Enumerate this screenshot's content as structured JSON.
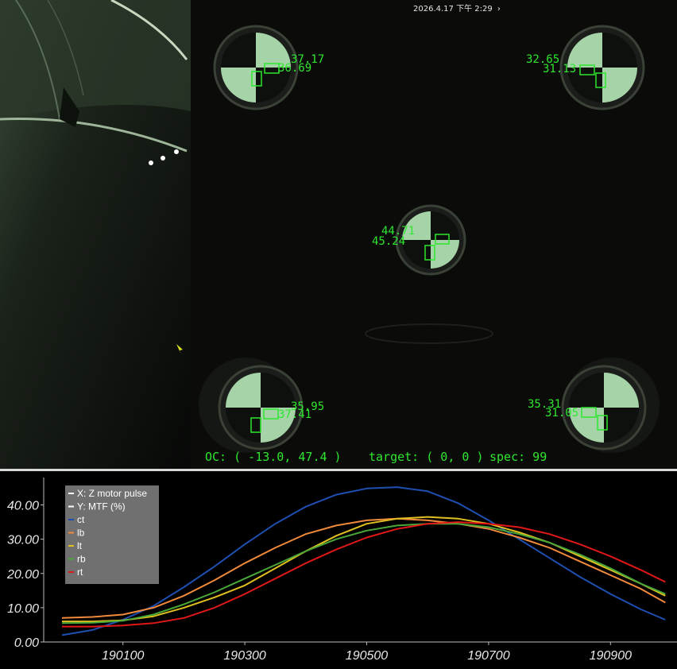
{
  "status_bar": {
    "timestamp": "2026.4.17 下午 2:29",
    "arrow_glyph": "›"
  },
  "camera": {
    "targets": [
      {
        "name": "lt",
        "value_a": "37.17",
        "value_b": "36.69"
      },
      {
        "name": "rt",
        "value_a": "32.65",
        "value_b": "31.13"
      },
      {
        "name": "ct",
        "value_a": "44.71",
        "value_b": "45.24"
      },
      {
        "name": "lb",
        "value_a": "35.95",
        "value_b": "37.41"
      },
      {
        "name": "rb",
        "value_a": "35.31",
        "value_b": "31.05"
      }
    ],
    "overlay": {
      "oc": "OC: ( -13.0, 47.4 )",
      "target": "target: ( 0, 0 )",
      "spec": "spec: 99"
    },
    "overlay_color": "#2fe62f"
  },
  "chart_data": {
    "type": "line",
    "x": [
      190000,
      190050,
      190100,
      190150,
      190200,
      190250,
      190300,
      190350,
      190400,
      190450,
      190500,
      190550,
      190600,
      190650,
      190700,
      190750,
      190800,
      190850,
      190900,
      190950,
      190990
    ],
    "series": [
      {
        "name": "ct",
        "color": "#1f4fb0",
        "values": [
          2.0,
          3.5,
          6.5,
          10.5,
          16.0,
          22.0,
          28.5,
          34.5,
          39.5,
          43.0,
          44.8,
          45.2,
          44.0,
          40.5,
          35.5,
          30.0,
          24.5,
          19.0,
          14.0,
          9.5,
          6.5
        ]
      },
      {
        "name": "lb",
        "color": "#f08a3c",
        "values": [
          7.0,
          7.3,
          8.0,
          10.0,
          13.5,
          18.0,
          23.0,
          27.5,
          31.5,
          34.0,
          35.5,
          36.0,
          35.5,
          34.5,
          33.0,
          30.5,
          27.5,
          23.5,
          19.5,
          15.5,
          11.5
        ]
      },
      {
        "name": "lt",
        "color": "#e0c020",
        "values": [
          6.0,
          6.0,
          6.3,
          7.5,
          10.0,
          13.0,
          16.5,
          21.5,
          26.5,
          31.0,
          34.5,
          36.0,
          36.5,
          36.0,
          34.5,
          32.0,
          29.0,
          25.0,
          21.0,
          17.0,
          13.5
        ]
      },
      {
        "name": "rb",
        "color": "#4aa83a",
        "values": [
          5.5,
          5.6,
          6.2,
          8.0,
          11.0,
          14.5,
          18.5,
          22.5,
          26.5,
          30.0,
          32.5,
          34.0,
          34.5,
          34.5,
          33.5,
          31.5,
          29.0,
          25.5,
          21.5,
          17.0,
          14.0
        ]
      },
      {
        "name": "rt",
        "color": "#e01818",
        "values": [
          4.5,
          4.5,
          4.8,
          5.5,
          7.0,
          10.0,
          14.0,
          18.5,
          23.0,
          27.0,
          30.5,
          33.0,
          34.5,
          35.0,
          34.5,
          33.5,
          31.5,
          28.5,
          25.0,
          21.0,
          17.5
        ]
      }
    ],
    "legend": {
      "x_label": "X: Z motor pulse",
      "y_label": "Y: MTF (%)",
      "placement": "top-left"
    },
    "x_ticks": [
      "190100",
      "190300",
      "190500",
      "190700",
      "190900"
    ],
    "x_tick_values": [
      190100,
      190300,
      190500,
      190700,
      190900
    ],
    "y_ticks": [
      "0.00",
      "10.00",
      "20.00",
      "30.00",
      "40.00"
    ],
    "y_tick_values": [
      0,
      10,
      20,
      30,
      40
    ],
    "xlim": [
      189970,
      191000
    ],
    "ylim": [
      0,
      48
    ]
  }
}
